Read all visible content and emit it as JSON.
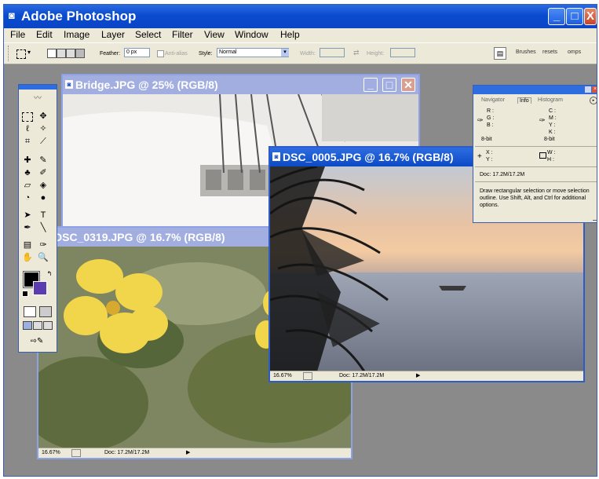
{
  "app": {
    "title": "Adobe Photoshop",
    "title_icon": "photoshop-logo-icon"
  },
  "window_controls": {
    "minimize": "_",
    "maximize": "□",
    "close": "X"
  },
  "menu": [
    "File",
    "Edit",
    "Image",
    "Layer",
    "Select",
    "Filter",
    "View",
    "Window",
    "Help"
  ],
  "options": {
    "feather_label": "Feather:",
    "feather_value": "0 px",
    "antialias_label": "Anti-alias",
    "style_label": "Style:",
    "style_value": "Normal",
    "width_label": "Width:",
    "height_label": "Height:",
    "palette_tabs": [
      "Brushes",
      "resets",
      "omps"
    ]
  },
  "documents": [
    {
      "title": "Bridge.JPG @ 25% (RGB/8)"
    },
    {
      "title": "DSC_0319.JPG @ 16.7% (RGB/8)",
      "zoom": "16.67%",
      "doc": "Doc: 17.2M/17.2M"
    },
    {
      "title": "DSC_0005.JPG @ 16.7% (RGB/8)",
      "zoom": "16.67%",
      "doc": "Doc: 17.2M/17.2M"
    }
  ],
  "info_panel": {
    "tabs": [
      "Navigator",
      "Info",
      "Histogram"
    ],
    "rgb": [
      "R :",
      "G :",
      "B :"
    ],
    "cmyk": [
      "C :",
      "M :",
      "Y :",
      "K :"
    ],
    "bit_left": "8-bit",
    "bit_right": "8-bit",
    "xy": [
      "X :",
      "Y :"
    ],
    "wh": [
      "W :",
      "H :"
    ],
    "doc": "Doc: 17.2M/17.2M",
    "help": "Draw rectangular selection or move selection outline.  Use Shift, Alt, and Ctrl for additional options."
  },
  "colors": {
    "titlebar": "#0a4bd0",
    "workspace": "#8a8a8a",
    "chrome": "#ece9d8"
  }
}
